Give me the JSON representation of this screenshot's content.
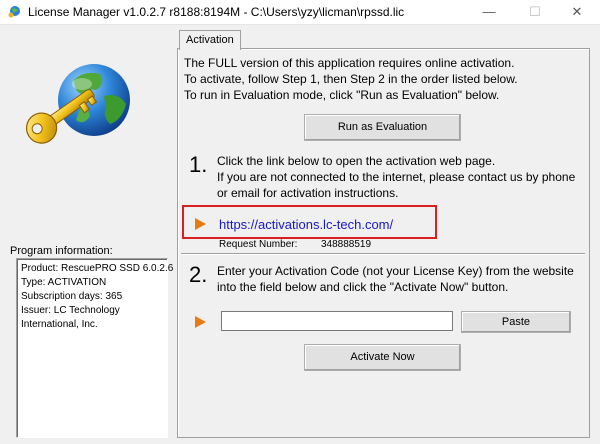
{
  "window": {
    "title": "License Manager v1.0.2.7 r8188:8194M - C:\\Users\\yzy\\licman\\rpssd.lic",
    "minimize": "—",
    "maximize": "☐",
    "close": "✕"
  },
  "program_info": {
    "label": "Program information:",
    "lines": [
      "Product: RescuePRO SSD 6.0.2.6",
      "Type: ACTIVATION",
      "Subscription days: 365",
      "Issuer: LC Technology",
      "International, Inc."
    ]
  },
  "tab": {
    "label": "Activation"
  },
  "intro": {
    "line1": "The FULL version of this application requires online activation.",
    "line2": "To activate, follow Step 1, then Step 2 in the order listed below.",
    "line3": "To run in Evaluation mode, click \"Run as Evaluation\" below."
  },
  "run_eval_button": "Run as Evaluation",
  "step1": {
    "number": "1.",
    "line1": "Click the link below to open the activation web page.",
    "line2": "If you are not connected to the internet, please contact us by phone",
    "line3": "or email for activation instructions.",
    "link": "https://activations.lc-tech.com/",
    "request_label": "Request Number:",
    "request_value": "348888519"
  },
  "step2": {
    "number": "2.",
    "line1": "Enter your Activation Code (not your License Key) from the website",
    "line2": "into the field below and click the \"Activate Now\" button.",
    "code_value": "",
    "paste_button": "Paste",
    "activate_button": "Activate Now"
  },
  "colors": {
    "arrow": "#e67a14",
    "link": "#1818cc",
    "highlight": "#d92020"
  }
}
